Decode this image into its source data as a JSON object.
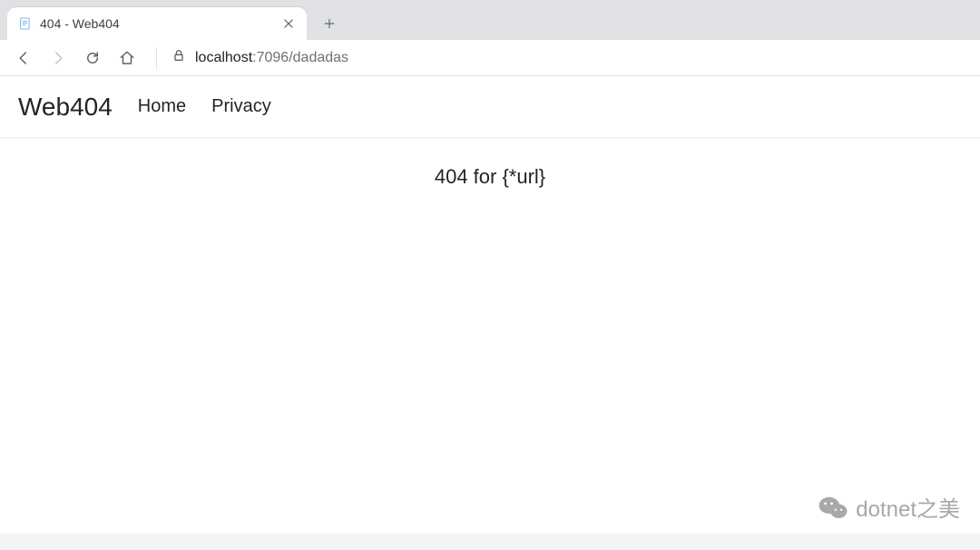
{
  "browser": {
    "tab": {
      "title": "404 - Web404",
      "favicon": "page-icon"
    },
    "toolbar": {
      "back": "←",
      "forward": "→",
      "reload": "⟳",
      "home": "⌂"
    },
    "address": {
      "lock_icon": "lock-icon",
      "host": "localhost",
      "port_path": ":7096/dadadas"
    },
    "new_tab": "+"
  },
  "page": {
    "navbar": {
      "brand": "Web404",
      "links": [
        "Home",
        "Privacy"
      ]
    },
    "message": "404 for {*url}"
  },
  "watermark": {
    "text": "dotnet之美",
    "icon": "wechat-icon"
  }
}
